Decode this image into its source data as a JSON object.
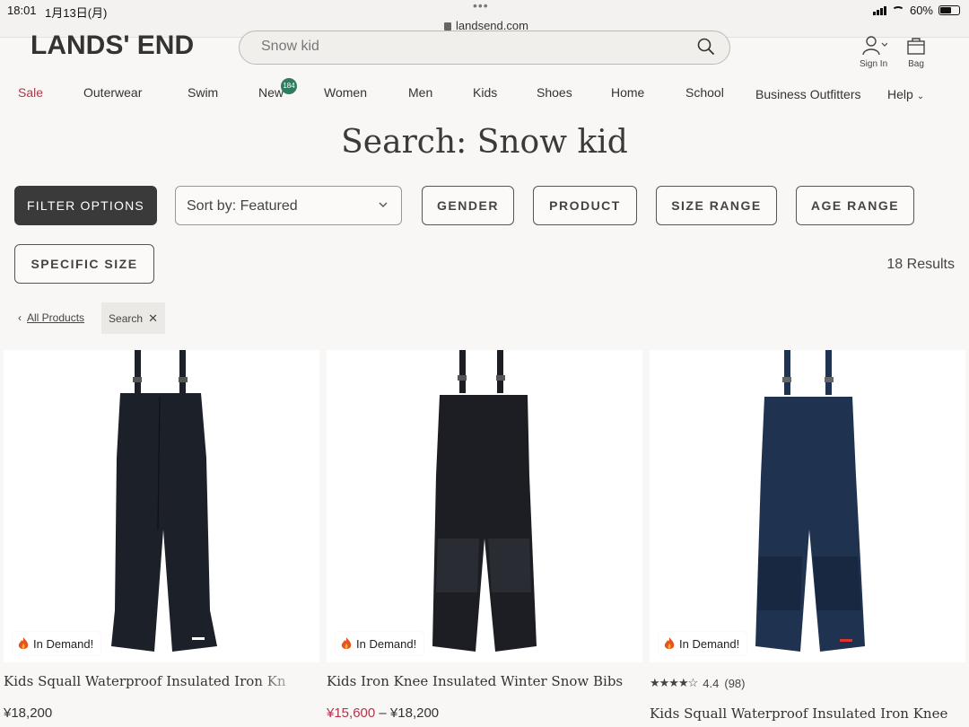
{
  "status_bar": {
    "time": "18:01",
    "date": "1月13日(月)",
    "url": "landsend.com",
    "battery": "60%"
  },
  "header": {
    "logo": "LANDS' END",
    "search_value": "Snow kid",
    "sign_in": "Sign In",
    "bag": "Bag"
  },
  "nav": {
    "items": [
      "Sale",
      "Outerwear",
      "Swim",
      "New",
      "Women",
      "Men",
      "Kids",
      "Shoes",
      "Home",
      "School",
      "Business Outfitters",
      "Help"
    ],
    "new_badge": "184"
  },
  "page_title": "Search: Snow kid",
  "filters": {
    "filter_options": "FILTER OPTIONS",
    "sort_label": "Sort by: Featured",
    "gender": "GENDER",
    "product": "PRODUCT",
    "size_range": "SIZE RANGE",
    "age_range": "AGE RANGE",
    "specific_size": "SPECIFIC SIZE",
    "results": "18 Results"
  },
  "breadcrumb": {
    "all_products": "All Products",
    "chip": "Search"
  },
  "products": [
    {
      "badge": "In Demand!",
      "name": "Kids Squall Waterproof Insulated Iron Kn",
      "price": "¥18,200",
      "color": "#1c2028"
    },
    {
      "badge": "In Demand!",
      "name": "Kids Iron Knee Insulated Winter Snow Bibs",
      "sale_price": "¥15,600",
      "price_sep": " – ",
      "price": "¥18,200",
      "color": "#1c1e24"
    },
    {
      "badge": "In Demand!",
      "rating_value": "4.4",
      "rating_count": "(98)",
      "name": "Kids Squall Waterproof Insulated Iron Knee",
      "color": "#1f3350"
    }
  ],
  "colors": {
    "accent_sale": "#b5334b",
    "badge_green": "#2e7d5e",
    "dark_button": "#3a3a3a"
  }
}
